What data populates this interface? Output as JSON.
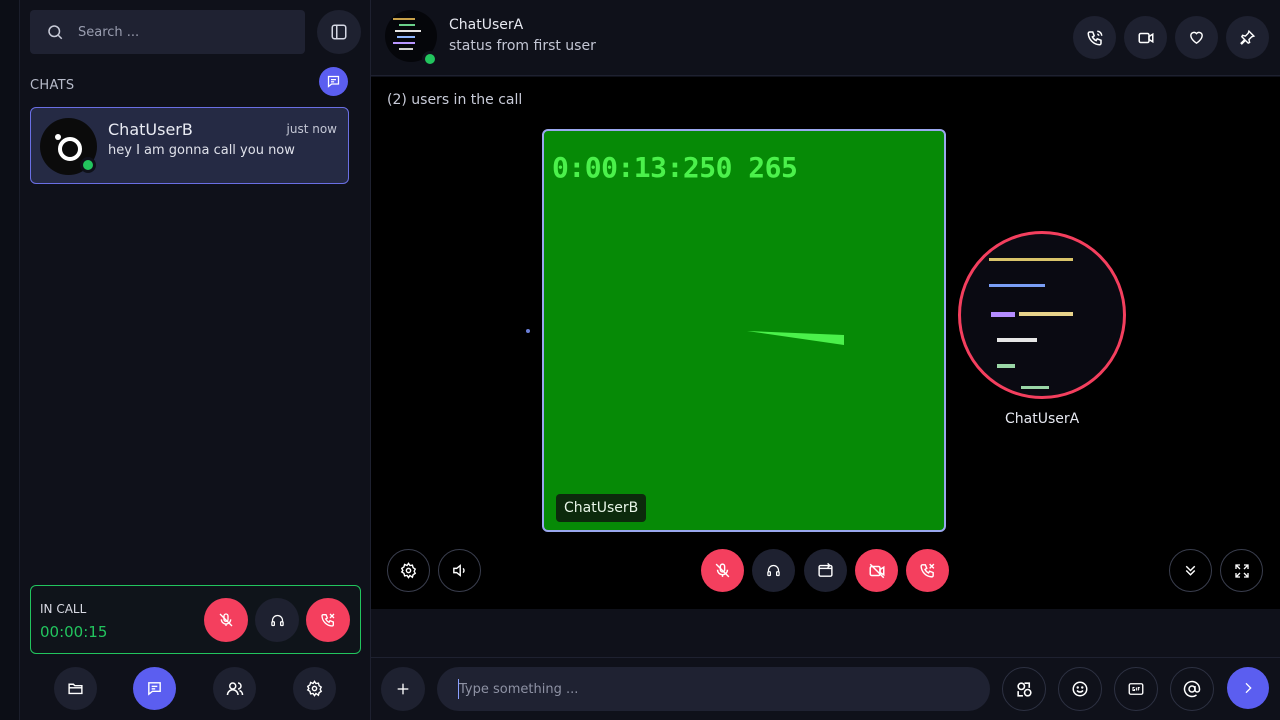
{
  "sidebar": {
    "search_placeholder": "Search ...",
    "chats_label": "CHATS",
    "chats": [
      {
        "name": "ChatUserB",
        "time": "just now",
        "preview": "hey I am gonna call you now"
      }
    ],
    "in_call": {
      "label": "IN CALL",
      "duration": "00:00:15"
    }
  },
  "header": {
    "name": "ChatUserA",
    "status": "status from first user"
  },
  "call": {
    "users_count_text": "(2) users in the call",
    "video_timer": "0:00:13:250 265",
    "video_user": "ChatUserB",
    "remote_user": "ChatUserA"
  },
  "composer": {
    "placeholder": "Type something ..."
  },
  "colors": {
    "accent": "#5b5ef0",
    "danger": "#f43f5e",
    "online": "#22c55e",
    "video_bg": "#068a06"
  }
}
